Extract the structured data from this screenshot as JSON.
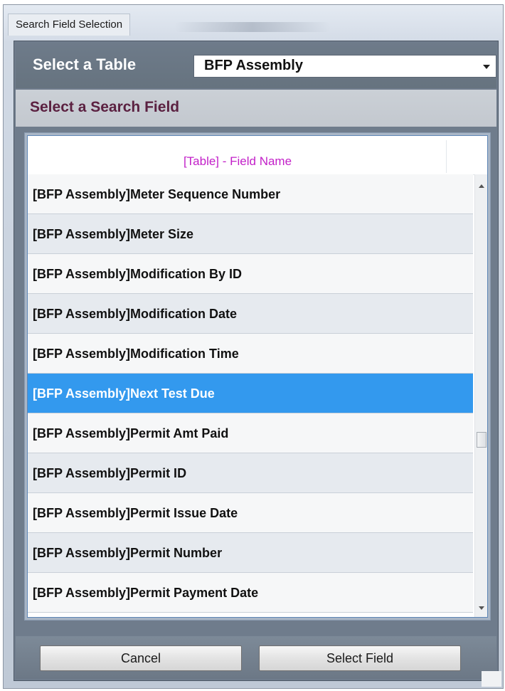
{
  "window": {
    "title": "Search Field Selection"
  },
  "table_selector": {
    "label": "Select a Table",
    "selected_value": "BFP Assembly"
  },
  "search_field": {
    "label": "Select a Search Field"
  },
  "list": {
    "header": "[Table] - Field Name",
    "selected_index": 5,
    "rows": [
      "[BFP Assembly]Meter Sequence Number",
      "[BFP Assembly]Meter Size",
      "[BFP Assembly]Modification By ID",
      "[BFP Assembly]Modification Date",
      "[BFP Assembly]Modification Time",
      "[BFP Assembly]Next Test Due",
      "[BFP Assembly]Permit Amt Paid",
      "[BFP Assembly]Permit ID",
      "[BFP Assembly]Permit Issue Date",
      "[BFP Assembly]Permit Number",
      "[BFP Assembly]Permit Payment Date"
    ]
  },
  "buttons": {
    "cancel": "Cancel",
    "select_field": "Select Field"
  },
  "colors": {
    "selection": "#3399ee",
    "header_text": "#c21fc8",
    "search_label": "#5b2141"
  }
}
